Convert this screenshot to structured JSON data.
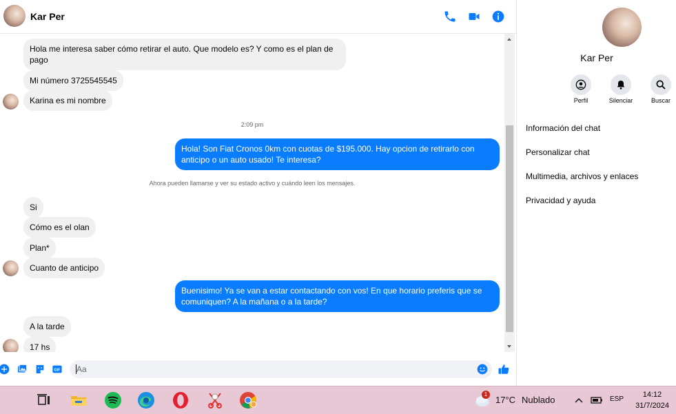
{
  "header": {
    "name": "Kar Per"
  },
  "messages": {
    "m1": "Hola me interesa saber cómo retirar el auto. Que modelo es? Y como es el plan de pago",
    "m2": "Mi número 3725545545",
    "m3": "Karina es mi nombre",
    "time1": "2:09 pm",
    "m4": "Hola! Son Fiat Cronos 0km con cuotas de $195.000. Hay opcion de retirarlo con anticipo o un auto usado! Te interesa?",
    "sys1": "Ahora pueden llamarse y ver su estado activo y cuándo leen los mensajes.",
    "m5": "Si",
    "m6": "Cómo es el olan",
    "m7": "Plan*",
    "m8": "Cuanto de anticipo",
    "m9": "Buenisimo! Ya se van a estar contactando con vos! En que horario preferis que se comuniquen? A la mañana o a la tarde?",
    "m10": "A la tarde",
    "m11": "17 hs"
  },
  "composer": {
    "placeholder": "Aa"
  },
  "sidebar": {
    "name": "Kar Per",
    "actions": {
      "profile": "Perfil",
      "mute": "Silenciar",
      "search": "Buscar"
    },
    "options": {
      "chat_info": "Información del chat",
      "customize": "Personalizar chat",
      "media": "Multimedia, archivos y enlaces",
      "privacy": "Privacidad y ayuda"
    }
  },
  "taskbar": {
    "weather_badge": "1",
    "temperature": "17°C",
    "weather": "Nublado",
    "language": "ESP",
    "time": "14:12",
    "date": "31/7/2024"
  },
  "colors": {
    "accent": "#0a7cff",
    "incoming_bubble": "#f0f0f0",
    "taskbar": "#e8c8d4"
  }
}
